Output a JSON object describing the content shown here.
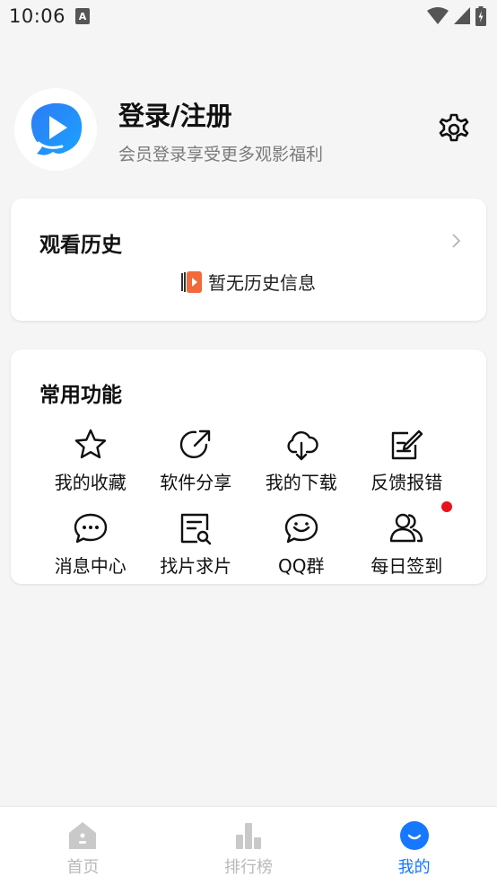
{
  "status": {
    "time": "10:06"
  },
  "profile": {
    "title": "登录/注册",
    "subtitle": "会员登录享受更多观影福利"
  },
  "history": {
    "title": "观看历史",
    "empty_text": "暂无历史信息"
  },
  "functions": {
    "title": "常用功能",
    "items": [
      {
        "label": "我的收藏",
        "icon": "star-icon"
      },
      {
        "label": "软件分享",
        "icon": "share-icon"
      },
      {
        "label": "我的下载",
        "icon": "cloud-download-icon"
      },
      {
        "label": "反馈报错",
        "icon": "edit-feedback-icon"
      },
      {
        "label": "消息中心",
        "icon": "chat-bubble-icon"
      },
      {
        "label": "找片求片",
        "icon": "search-document-icon"
      },
      {
        "label": "QQ群",
        "icon": "group-chat-icon"
      },
      {
        "label": "每日签到",
        "icon": "users-icon",
        "badge": true
      }
    ]
  },
  "nav": {
    "items": [
      {
        "label": "首页",
        "icon": "home-icon",
        "active": false
      },
      {
        "label": "排行榜",
        "icon": "bar-chart-icon",
        "active": false
      },
      {
        "label": "我的",
        "icon": "profile-icon",
        "active": true
      }
    ]
  },
  "colors": {
    "accent": "#1677ff",
    "badge": "#e8121b",
    "inactive": "#b9b9b9"
  }
}
